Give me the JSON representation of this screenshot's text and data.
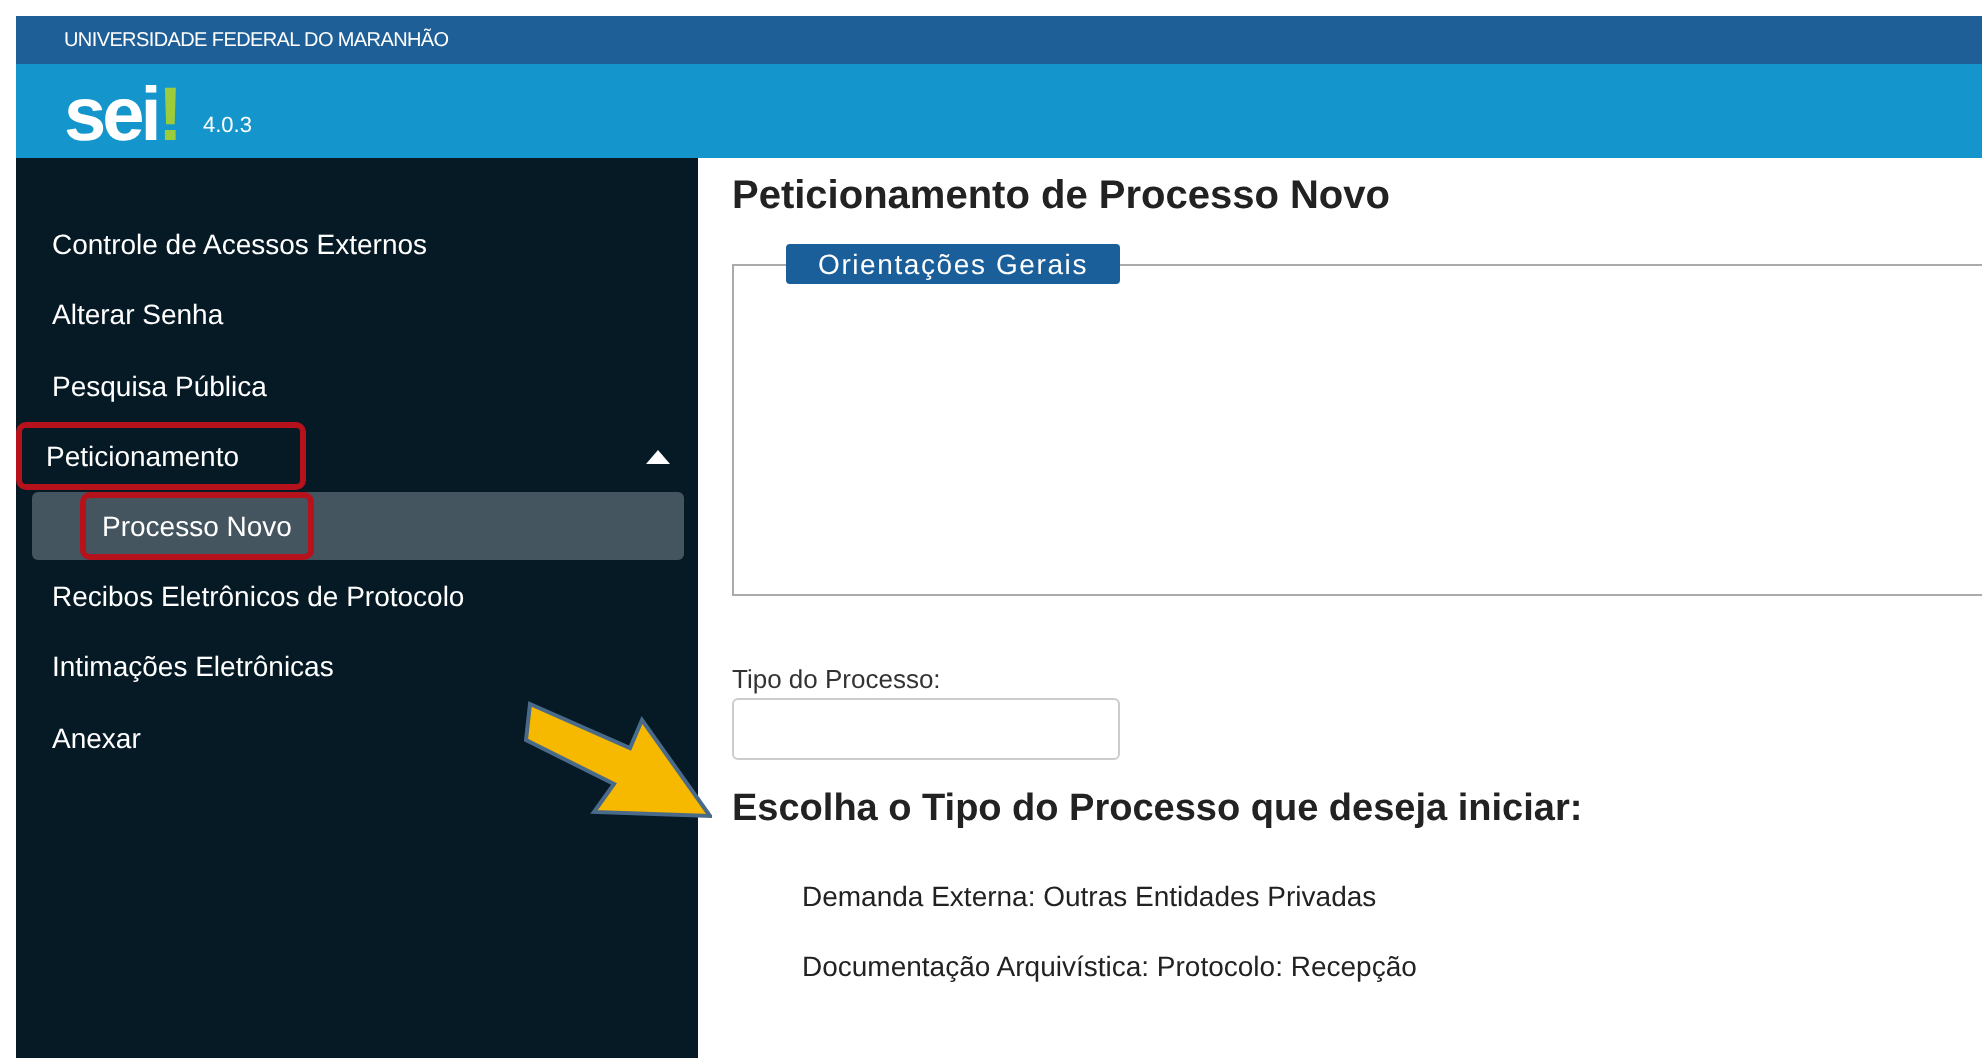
{
  "header": {
    "organization": "UNIVERSIDADE FEDERAL DO MARANHÃO",
    "logo": {
      "text": "sei",
      "mark": "!"
    },
    "version": "4.0.3"
  },
  "sidebar": {
    "items": [
      {
        "label": "Controle de Acessos Externos",
        "selected": false,
        "highlighted": false
      },
      {
        "label": "Alterar Senha",
        "selected": false,
        "highlighted": false
      },
      {
        "label": "Pesquisa Pública",
        "selected": false,
        "highlighted": false
      },
      {
        "label": "Peticionamento",
        "selected": false,
        "highlighted": true,
        "expanded": true,
        "children": [
          {
            "label": "Processo Novo",
            "selected": true,
            "highlighted": true
          }
        ]
      },
      {
        "label": "Recibos Eletrônicos de Protocolo",
        "selected": false,
        "highlighted": false
      },
      {
        "label": "Intimações Eletrônicas",
        "selected": false,
        "highlighted": false
      },
      {
        "label": "Anexar",
        "selected": false,
        "highlighted": false
      }
    ]
  },
  "main": {
    "title": "Peticionamento de Processo Novo",
    "fieldset": {
      "legend": "Orientações Gerais"
    },
    "process_type": {
      "label": "Tipo do Processo:"
    },
    "heading": "Escolha o Tipo do Processo que deseja iniciar:",
    "options": [
      "Demanda Externa: Outras Entidades Privadas",
      "Documentação Arquivística: Protocolo: Recepção"
    ]
  },
  "annotation": {
    "kind": "arrow"
  }
}
